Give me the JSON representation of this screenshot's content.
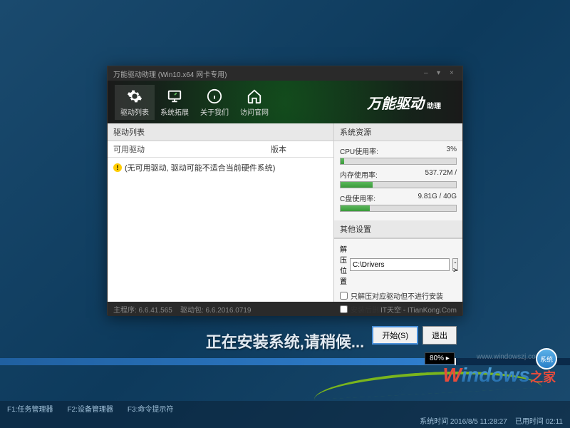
{
  "window": {
    "title": "万能驱动助理 (Win10.x64 网卡专用)"
  },
  "nav": {
    "items": [
      {
        "label": "驱动列表"
      },
      {
        "label": "系统拓展"
      },
      {
        "label": "关于我们"
      },
      {
        "label": "访问官网"
      }
    ]
  },
  "brand": {
    "main": "万能驱动",
    "sub": "助理"
  },
  "driver_panel": {
    "title": "驱动列表",
    "col_driver": "可用驱动",
    "col_version": "版本",
    "empty_msg": "(无可用驱动, 驱动可能不适合当前硬件系统)"
  },
  "resources": {
    "title": "系统资源",
    "cpu": {
      "label": "CPU使用率:",
      "value": "3%",
      "percent": 3
    },
    "mem": {
      "label": "内存使用率:",
      "value": "537.72M /",
      "percent": 28
    },
    "disk": {
      "label": "C盘使用率:",
      "value": "9.81G / 40G",
      "percent": 25
    }
  },
  "settings": {
    "title": "其他设置",
    "extract_label": "解压位置",
    "extract_path": "C:\\Drivers",
    "browse": "->",
    "opt1": "只解压对应驱动但不进行安装",
    "opt2": "安装后删除已解压的驱动文件"
  },
  "actions": {
    "start": "开始(S)",
    "exit": "退出"
  },
  "footer": {
    "main_ver": "主程序: 6.6.41.565",
    "pack_ver": "驱动包: 6.6.2016.0719",
    "site": "IT天空 - ITianKong.Com"
  },
  "installer": {
    "text": "正在安装系统,请稍候...",
    "percent": "80%",
    "watermark": "www.windowszj.com"
  },
  "logo": {
    "badge": "系统",
    "zhijia": "之家"
  },
  "taskbar": {
    "hint1": "F1:任务管理器",
    "hint2": "F2:设备管理器",
    "hint3": "F3:命令提示符",
    "systime_label": "系统时间",
    "systime": "2016/8/5 11:28:27",
    "elapsed_label": "已用时间",
    "elapsed": "02:11"
  }
}
